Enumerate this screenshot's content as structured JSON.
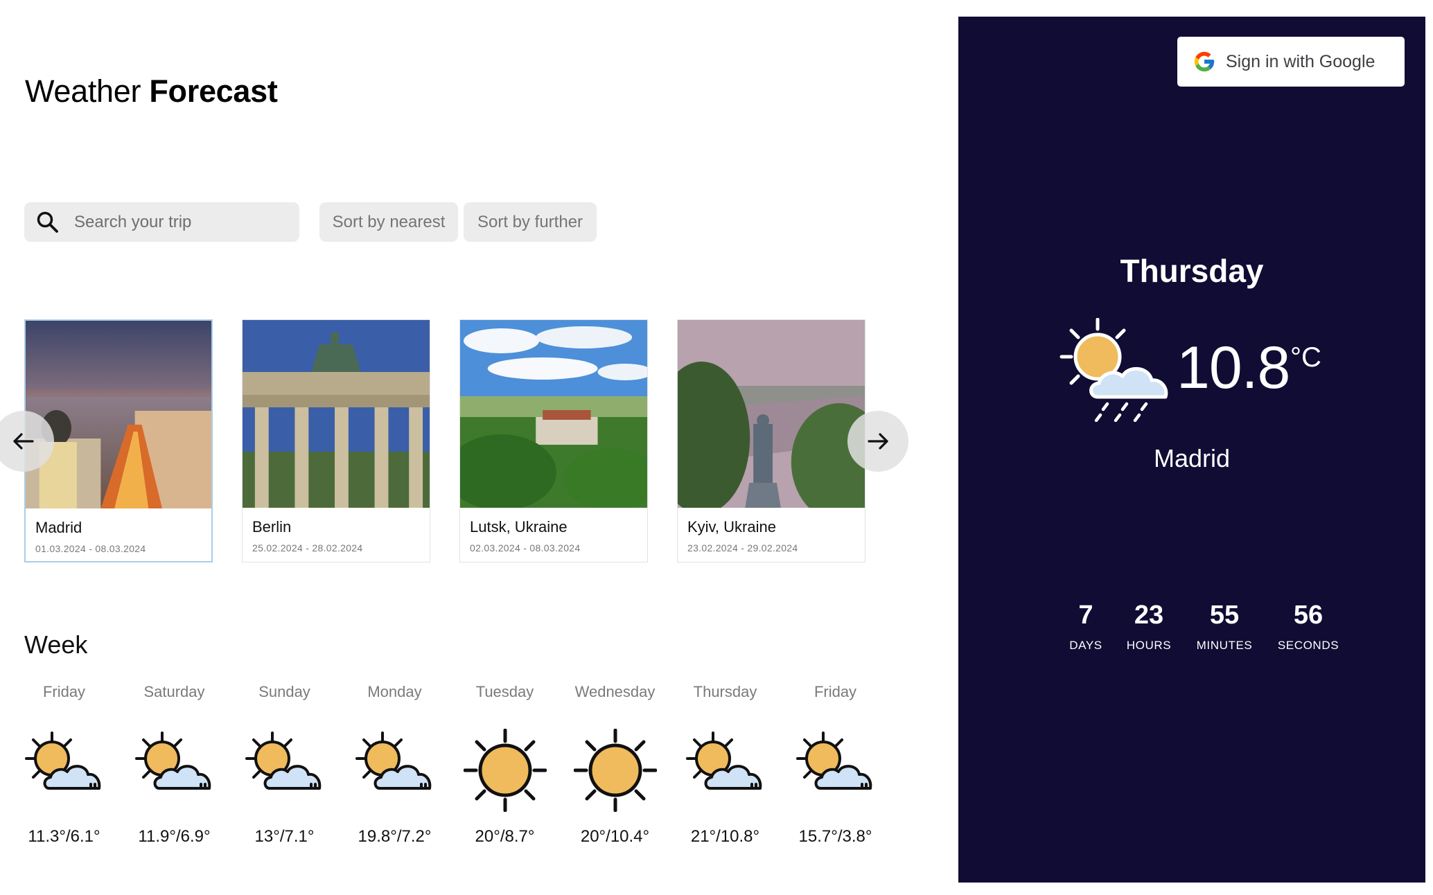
{
  "header": {
    "title_light": "Weather",
    "title_bold": "Forecast"
  },
  "search": {
    "placeholder": "Search your trip",
    "value": ""
  },
  "sort": {
    "nearest_label": "Sort by nearest",
    "further_label": "Sort by further"
  },
  "trips": [
    {
      "city": "Madrid",
      "dates": "01.03.2024 - 08.03.2024",
      "selected": true
    },
    {
      "city": "Berlin",
      "dates": "25.02.2024 - 28.02.2024",
      "selected": false
    },
    {
      "city": "Lutsk, Ukraine",
      "dates": "02.03.2024 - 08.03.2024",
      "selected": false
    },
    {
      "city": "Kyiv, Ukraine",
      "dates": "23.02.2024 - 29.02.2024",
      "selected": false
    }
  ],
  "carousel": {
    "prev_icon": "arrow-left-icon",
    "next_icon": "arrow-right-icon"
  },
  "week": {
    "title": "Week",
    "days": [
      {
        "name": "Friday",
        "icon": "partly-cloudy-icon",
        "temps": "11.3°/6.1°"
      },
      {
        "name": "Saturday",
        "icon": "partly-cloudy-icon",
        "temps": "11.9°/6.9°"
      },
      {
        "name": "Sunday",
        "icon": "partly-cloudy-icon",
        "temps": "13°/7.1°"
      },
      {
        "name": "Monday",
        "icon": "partly-cloudy-icon",
        "temps": "19.8°/7.2°"
      },
      {
        "name": "Tuesday",
        "icon": "sun-icon",
        "temps": "20°/8.7°"
      },
      {
        "name": "Wednesday",
        "icon": "sun-icon",
        "temps": "20°/10.4°"
      },
      {
        "name": "Thursday",
        "icon": "partly-cloudy-icon",
        "temps": "21°/10.8°"
      },
      {
        "name": "Friday",
        "icon": "partly-cloudy-icon",
        "temps": "15.7°/3.8°"
      }
    ]
  },
  "panel": {
    "google_button": "Sign in with Google",
    "day": "Thursday",
    "icon": "sun-cloud-rain-icon",
    "temperature": "10.8",
    "unit": "°C",
    "city": "Madrid",
    "countdown": [
      {
        "value": "7",
        "label": "DAYS"
      },
      {
        "value": "23",
        "label": "HOURS"
      },
      {
        "value": "55",
        "label": "MINUTES"
      },
      {
        "value": "56",
        "label": "SECONDS"
      }
    ]
  },
  "colors": {
    "panel_bg": "#100c33",
    "sun": "#f0bb5c",
    "cloud": "#cfe2f6",
    "selected_border": "#a8cdea",
    "button_bg": "#ececec"
  }
}
